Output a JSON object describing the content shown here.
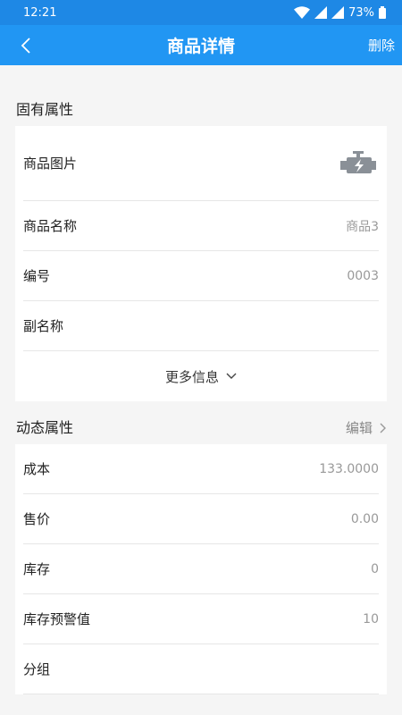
{
  "status_bar": {
    "time": "12:21",
    "battery": "73%"
  },
  "app_bar": {
    "title": "商品详情",
    "action": "删除"
  },
  "fixed_section": {
    "heading": "固有属性",
    "image_label": "商品图片",
    "rows": [
      {
        "label": "商品名称",
        "value": "商品3"
      },
      {
        "label": "编号",
        "value": "0003"
      },
      {
        "label": "副名称",
        "value": ""
      }
    ],
    "more_label": "更多信息"
  },
  "dynamic_section": {
    "heading": "动态属性",
    "edit_label": "编辑",
    "rows": [
      {
        "label": "成本",
        "value": "133.0000"
      },
      {
        "label": "售价",
        "value": "0.00"
      },
      {
        "label": "库存",
        "value": "0"
      },
      {
        "label": "库存预警值",
        "value": "10"
      },
      {
        "label": "分组",
        "value": ""
      }
    ]
  },
  "colors": {
    "status_bar": "#1e88e5",
    "app_bar": "#2196f3",
    "icon_gray": "#8a9097"
  },
  "icons": [
    "wifi-icon",
    "signal-icon",
    "battery-icon",
    "back-arrow-icon",
    "engine-icon",
    "chevron-down-icon",
    "chevron-right-icon"
  ]
}
